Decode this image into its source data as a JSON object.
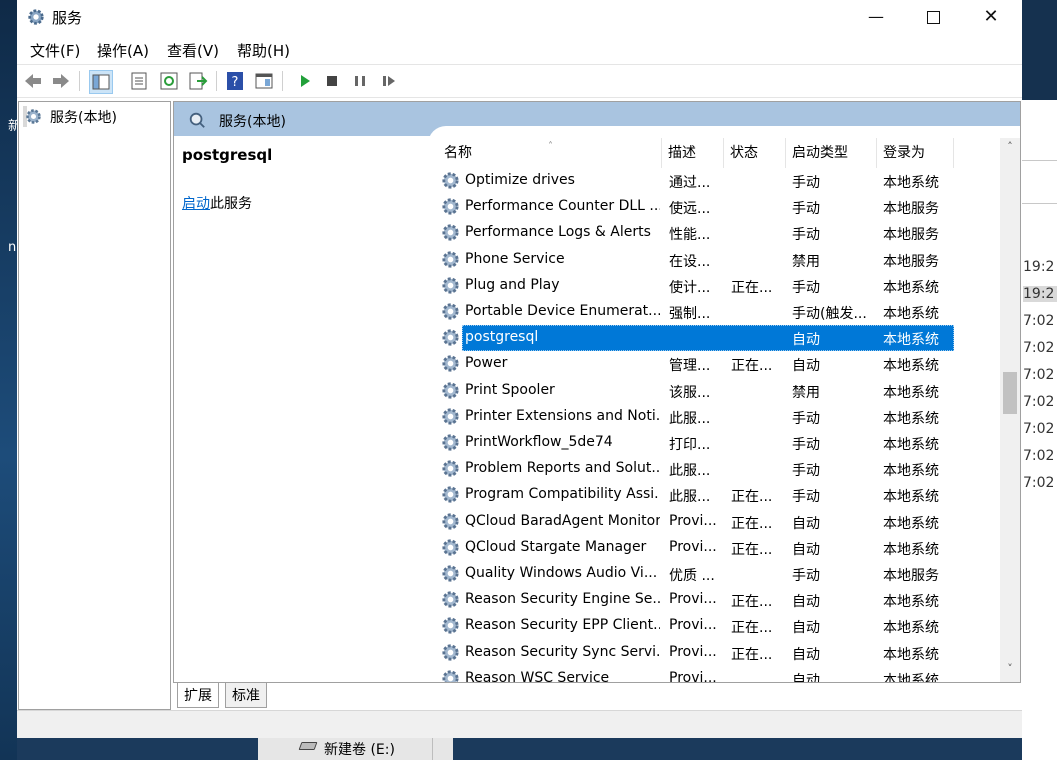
{
  "window": {
    "title": "服务"
  },
  "menu": [
    "文件(F)",
    "操作(A)",
    "查看(V)",
    "帮助(H)"
  ],
  "toolbar": {
    "icons": [
      "back-arrow-icon",
      "forward-arrow-icon",
      "show-tree-icon",
      "properties-icon",
      "refresh-icon",
      "export-icon",
      "help-icon",
      "console-view-icon",
      "start-service-icon",
      "stop-service-icon",
      "pause-service-icon",
      "restart-service-icon"
    ]
  },
  "tree": {
    "root_label": "服务(本地)"
  },
  "panel": {
    "header": "服务(本地)",
    "selected_service": "postgresql",
    "action_link": "启动",
    "action_suffix": "此服务"
  },
  "columns": [
    "名称",
    "描述",
    "状态",
    "启动类型",
    "登录为"
  ],
  "services": [
    {
      "name": "Optimize drives",
      "desc": "通过...",
      "status": "",
      "startup": "手动",
      "logon": "本地系统"
    },
    {
      "name": "Performance Counter DLL ...",
      "desc": "使远...",
      "status": "",
      "startup": "手动",
      "logon": "本地服务"
    },
    {
      "name": "Performance Logs & Alerts",
      "desc": "性能...",
      "status": "",
      "startup": "手动",
      "logon": "本地服务"
    },
    {
      "name": "Phone Service",
      "desc": "在设...",
      "status": "",
      "startup": "禁用",
      "logon": "本地服务"
    },
    {
      "name": "Plug and Play",
      "desc": "使计...",
      "status": "正在...",
      "startup": "手动",
      "logon": "本地系统"
    },
    {
      "name": "Portable Device Enumerat...",
      "desc": "强制...",
      "status": "",
      "startup": "手动(触发...",
      "logon": "本地系统"
    },
    {
      "name": "postgresql",
      "desc": "",
      "status": "",
      "startup": "自动",
      "logon": "本地系统"
    },
    {
      "name": "Power",
      "desc": "管理...",
      "status": "正在...",
      "startup": "自动",
      "logon": "本地系统"
    },
    {
      "name": "Print Spooler",
      "desc": "该服...",
      "status": "",
      "startup": "禁用",
      "logon": "本地系统"
    },
    {
      "name": "Printer Extensions and Noti...",
      "desc": "此服...",
      "status": "",
      "startup": "手动",
      "logon": "本地系统"
    },
    {
      "name": "PrintWorkflow_5de74",
      "desc": "打印...",
      "status": "",
      "startup": "手动",
      "logon": "本地系统"
    },
    {
      "name": "Problem Reports and Solut...",
      "desc": "此服...",
      "status": "",
      "startup": "手动",
      "logon": "本地系统"
    },
    {
      "name": "Program Compatibility Assi...",
      "desc": "此服...",
      "status": "正在...",
      "startup": "手动",
      "logon": "本地系统"
    },
    {
      "name": "QCloud BaradAgent Monitor",
      "desc": "Provi...",
      "status": "正在...",
      "startup": "自动",
      "logon": "本地系统"
    },
    {
      "name": "QCloud Stargate Manager",
      "desc": "Provi...",
      "status": "正在...",
      "startup": "自动",
      "logon": "本地系统"
    },
    {
      "name": "Quality Windows Audio Vi...",
      "desc": "优质 ...",
      "status": "",
      "startup": "手动",
      "logon": "本地服务"
    },
    {
      "name": "Reason Security Engine Se...",
      "desc": "Provi...",
      "status": "正在...",
      "startup": "自动",
      "logon": "本地系统"
    },
    {
      "name": "Reason Security EPP Client...",
      "desc": "Provi...",
      "status": "正在...",
      "startup": "自动",
      "logon": "本地系统"
    },
    {
      "name": "Reason Security Sync Servi...",
      "desc": "Provi...",
      "status": "正在...",
      "startup": "自动",
      "logon": "本地系统"
    },
    {
      "name": "Reason WSC Service",
      "desc": "Provi...",
      "status": "",
      "startup": "自动",
      "logon": "本地系统"
    }
  ],
  "selected_index": 6,
  "tabs": [
    "扩展",
    "标准"
  ],
  "background": {
    "right_times": [
      "19:2",
      "19:2",
      "7:02",
      "7:02",
      "7:02",
      "7:02",
      "7:02",
      "7:02",
      "7:02"
    ],
    "taskbar_item": "新建卷 (E:)",
    "left_chars": [
      "新",
      "n"
    ]
  },
  "colors": {
    "selection": "#0078d7",
    "panel_header": "#a9c4e0",
    "link": "#0066cc"
  }
}
